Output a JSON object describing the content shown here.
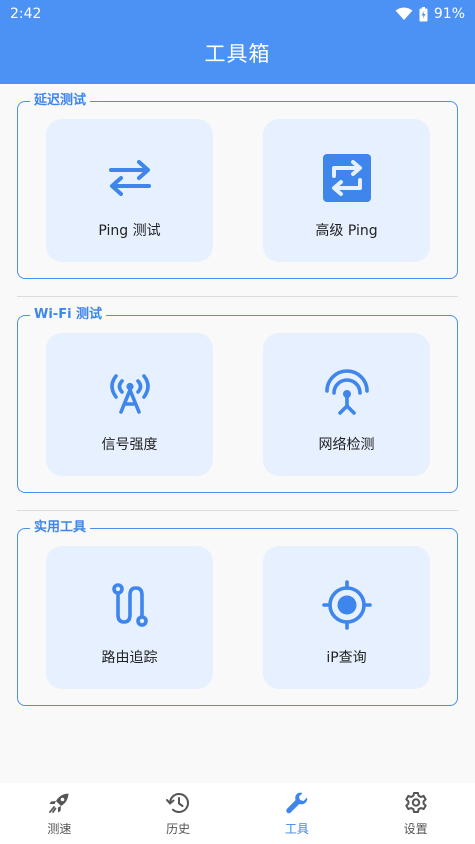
{
  "status": {
    "time": "2:42",
    "battery": "91%"
  },
  "app": {
    "title": "工具箱"
  },
  "groups": [
    {
      "title": "延迟测试",
      "items": [
        {
          "label": "Ping 测试",
          "icon": "swap-arrows-icon"
        },
        {
          "label": "高级 Ping",
          "icon": "repeat-box-icon"
        }
      ]
    },
    {
      "title": "Wi-Fi 测试",
      "items": [
        {
          "label": "信号强度",
          "icon": "antenna-icon"
        },
        {
          "label": "网络检测",
          "icon": "broadcast-tower-icon"
        }
      ]
    },
    {
      "title": "实用工具",
      "items": [
        {
          "label": "路由追踪",
          "icon": "route-icon"
        },
        {
          "label": "iP查询",
          "icon": "crosshair-icon"
        }
      ]
    }
  ],
  "nav": {
    "items": [
      {
        "label": "测速",
        "icon": "rocket-icon"
      },
      {
        "label": "历史",
        "icon": "history-icon"
      },
      {
        "label": "工具",
        "icon": "wrench-icon"
      },
      {
        "label": "设置",
        "icon": "gear-icon"
      }
    ],
    "active": "工具",
    "accent": "#3E86EC"
  },
  "colors": {
    "appbar": "#4B92F4",
    "accent": "#3E86EC",
    "card": "#E6F0FF"
  }
}
